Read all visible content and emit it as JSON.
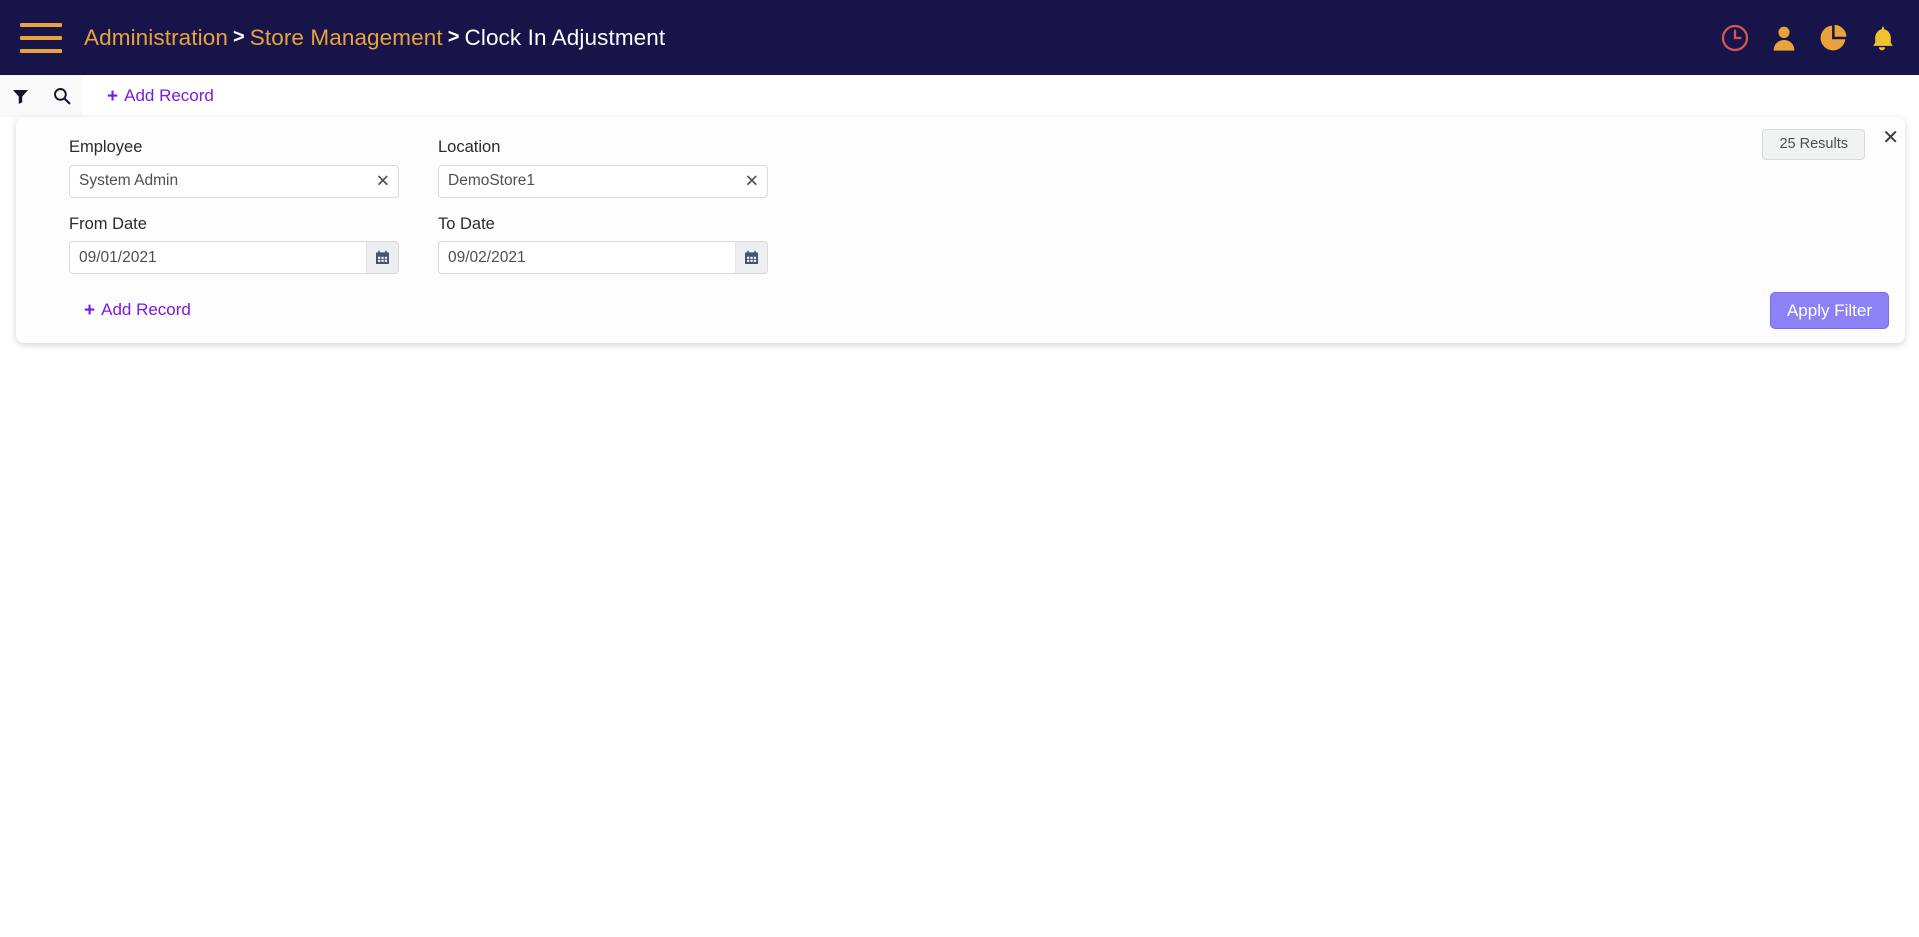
{
  "topbar": {
    "menu_icon": "hamburger-icon",
    "breadcrumb": {
      "items": [
        {
          "label": "Administration",
          "current": false
        },
        {
          "label": "Store Management",
          "current": false
        },
        {
          "label": "Clock In Adjustment",
          "current": true
        }
      ],
      "separator": ">"
    },
    "icons": [
      {
        "name": "clock-icon",
        "color": "#D9534F"
      },
      {
        "name": "user-icon",
        "color": "#E8A33D"
      },
      {
        "name": "pie-chart-icon",
        "color": "#E8A33D"
      },
      {
        "name": "bell-icon",
        "color": "#EFC32B"
      }
    ],
    "background_color": "#171449",
    "accent_color": "#E8A33D"
  },
  "toolbar": {
    "filter_icon": "filter-funnel-icon",
    "search_icon": "search-icon",
    "add_record_label": "Add Record",
    "plus_glyph": "+",
    "link_color": "#7B19E0"
  },
  "filter_panel": {
    "results_badge": "25 Results",
    "close_glyph": "✕",
    "apply_label": "Apply Filter",
    "apply_color": "#8D82F5",
    "add_record_label": "Add Record",
    "fields": [
      {
        "label": "Employee",
        "value": "System Admin",
        "placeholder": "Employee",
        "clearable": true,
        "type": "select"
      },
      {
        "label": "Location",
        "value": "DemoStore1",
        "placeholder": "Location",
        "clearable": true,
        "type": "select"
      },
      {
        "label": "From Date",
        "value": "09/01/2021",
        "placeholder": "mm/dd/yyyy",
        "clearable": false,
        "type": "date"
      },
      {
        "label": "To Date",
        "value": "09/02/2021",
        "placeholder": "mm/dd/yyyy",
        "clearable": false,
        "type": "date"
      }
    ]
  }
}
